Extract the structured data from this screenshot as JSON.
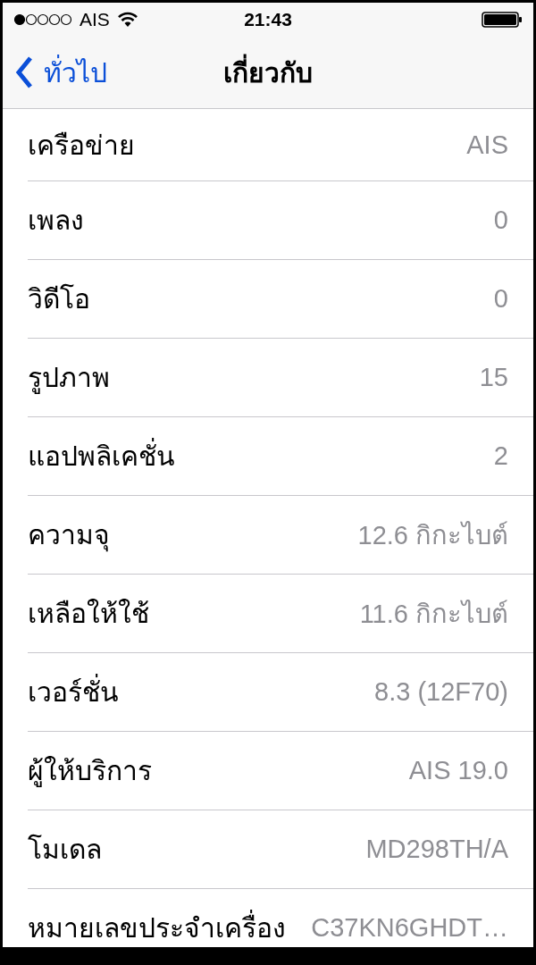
{
  "status_bar": {
    "carrier": "AIS",
    "time": "21:43"
  },
  "nav": {
    "back": "ทั่วไป",
    "title": "เกี่ยวกับ"
  },
  "rows": [
    {
      "label": "เครือข่าย",
      "value": "AIS"
    },
    {
      "label": "เพลง",
      "value": "0"
    },
    {
      "label": "วิดีโอ",
      "value": "0"
    },
    {
      "label": "รูปภาพ",
      "value": "15"
    },
    {
      "label": "แอปพลิเคชั่น",
      "value": "2"
    },
    {
      "label": "ความจุ",
      "value": "12.6 กิกะไบต์"
    },
    {
      "label": "เหลือให้ใช้",
      "value": "11.6 กิกะไบต์"
    },
    {
      "label": "เวอร์ชั่น",
      "value": "8.3 (12F70)"
    },
    {
      "label": "ผู้ให้บริการ",
      "value": "AIS 19.0"
    },
    {
      "label": "โมเดล",
      "value": "MD298TH/A"
    },
    {
      "label": "หมายเลขประจำเครื่อง",
      "value": "C37KN6GHDT…"
    }
  ]
}
